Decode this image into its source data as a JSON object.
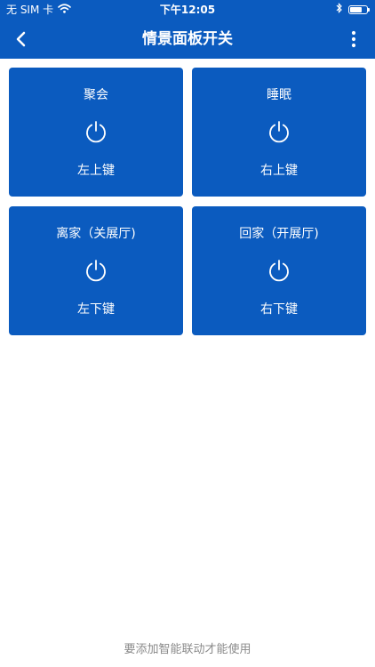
{
  "status_bar": {
    "carrier": "无 SIM 卡",
    "time": "下午12:05",
    "battery_level": 0.7
  },
  "nav": {
    "title": "情景面板开关"
  },
  "panels": [
    {
      "scene": "聚会",
      "key": "左上键"
    },
    {
      "scene": "睡眠",
      "key": "右上键"
    },
    {
      "scene": "离家（关展厅)",
      "key": "左下键"
    },
    {
      "scene": "回家（开展厅)",
      "key": "右下键"
    }
  ],
  "footer": {
    "note": "要添加智能联动才能使用"
  },
  "colors": {
    "primary": "#0b5bbf",
    "background": "#ffffff",
    "footer_text": "#8a8a8a"
  }
}
